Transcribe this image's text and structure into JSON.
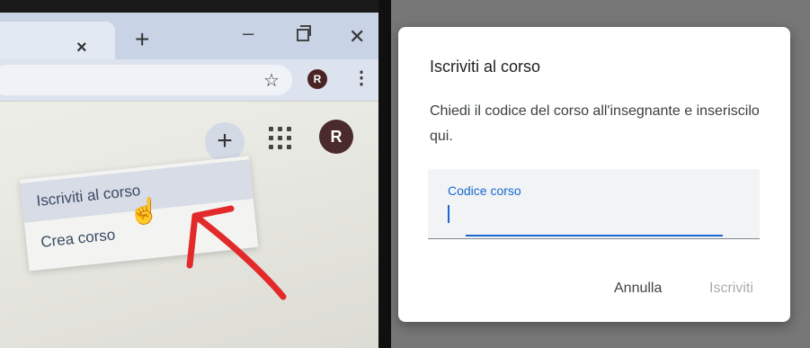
{
  "photo": {
    "tab_close_glyph": "×",
    "new_tab_glyph": "+",
    "minimize_glyph": "–",
    "close_glyph": "✕",
    "star_glyph": "☆",
    "profile_initial_small": "R",
    "menu_glyph": "⋮",
    "create_glyph": "+",
    "profile_initial_big": "R",
    "menu_items": [
      {
        "label": "Iscriviti al corso"
      },
      {
        "label": "Crea corso"
      }
    ],
    "hand_glyph": "☝",
    "arrow_color": "#e32a2a"
  },
  "dialog": {
    "title": "Iscriviti al corso",
    "description": "Chiedi il codice del corso all'insegnante e inseriscilo qui.",
    "field_label": "Codice corso",
    "field_value": "",
    "cancel_label": "Annulla",
    "submit_label": "Iscriviti",
    "accent_color": "#1967d2"
  }
}
